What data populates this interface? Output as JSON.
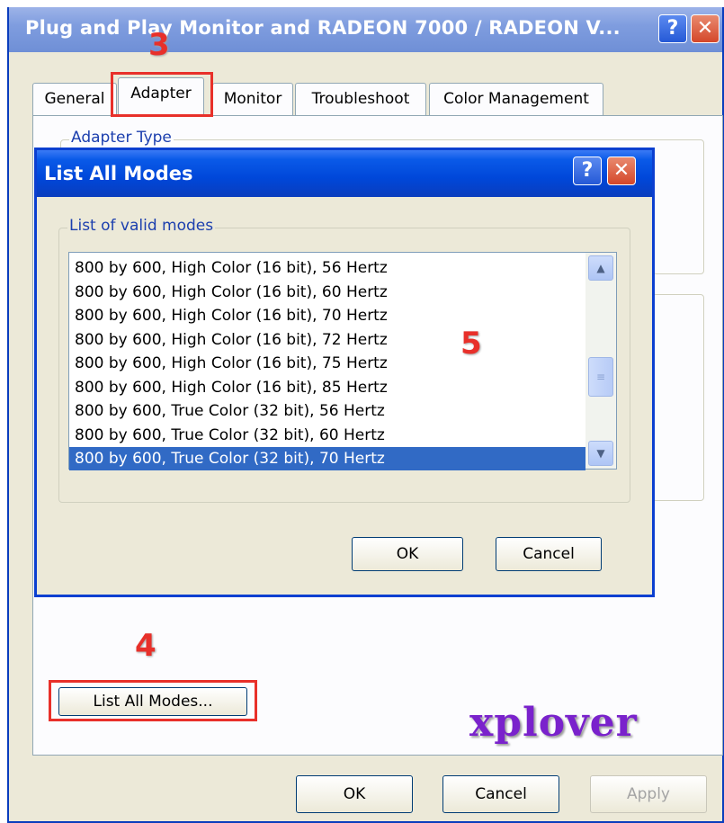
{
  "window": {
    "title": "Plug and Play Monitor and RADEON 7000 / RADEON V...",
    "help_glyph": "?",
    "close_glyph": "✕"
  },
  "tabs": [
    {
      "label": "General"
    },
    {
      "label": "Adapter"
    },
    {
      "label": "Monitor"
    },
    {
      "label": "Troubleshoot"
    },
    {
      "label": "Color Management"
    }
  ],
  "adapter_panel": {
    "adapter_type_label": "Adapter Type",
    "list_all_modes_button": "List All Modes...",
    "ok_button": "OK",
    "cancel_button": "Cancel",
    "apply_button": "Apply"
  },
  "dialog": {
    "title": "List All Modes",
    "group_label": "List of valid modes",
    "modes": [
      "800 by 600, High Color (16 bit), 56 Hertz",
      "800 by 600, High Color (16 bit), 60 Hertz",
      "800 by 600, High Color (16 bit), 70 Hertz",
      "800 by 600, High Color (16 bit), 72 Hertz",
      "800 by 600, High Color (16 bit), 75 Hertz",
      "800 by 600, High Color (16 bit), 85 Hertz",
      "800 by 600, True Color (32 bit), 56 Hertz",
      "800 by 600, True Color (32 bit), 60 Hertz",
      "800 by 600, True Color (32 bit), 70 Hertz"
    ],
    "selected_index": 8,
    "ok_button": "OK",
    "cancel_button": "Cancel"
  },
  "annotations": {
    "step3": "3",
    "step4": "4",
    "step5": "5",
    "color": "#e8302a"
  },
  "watermark": "xplover",
  "colors": {
    "selection": "#316ac5",
    "title_blue": "#0a3dbd",
    "window_bg": "#ece9d8",
    "watermark": "#7a22cc"
  }
}
